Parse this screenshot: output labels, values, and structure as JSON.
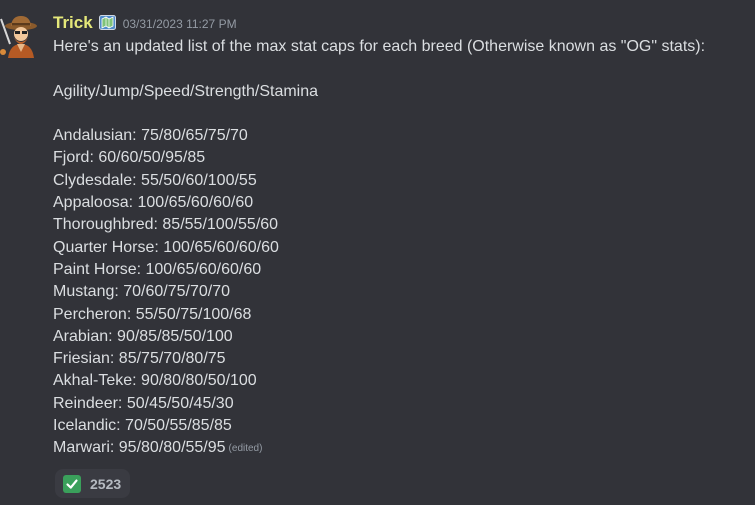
{
  "author": {
    "username": "Trick",
    "role_icon": "map-icon",
    "avatar": "cowboy-avatar",
    "name_color": "#e5e87a"
  },
  "timestamp": "03/31/2023 11:27 PM",
  "message": {
    "intro": "Here's an updated list of the max stat caps for each breed (Otherwise known as \"OG\" stats):",
    "stat_order": "Agility/Jump/Speed/Strength/Stamina",
    "breeds": [
      "Andalusian: 75/80/65/75/70",
      "Fjord: 60/60/50/95/85",
      "Clydesdale: 55/50/60/100/55",
      "Appaloosa: 100/65/60/60/60",
      "Thoroughbred: 85/55/100/55/60",
      "Quarter Horse: 100/65/60/60/60",
      "Paint Horse: 100/65/60/60/60",
      "Mustang: 70/60/75/70/70",
      "Percheron: 55/50/75/100/68",
      "Arabian: 90/85/85/50/100",
      "Friesian: 85/75/70/80/75",
      "Akhal-Teke: 90/80/80/50/100",
      "Reindeer: 50/45/50/45/30",
      "Icelandic: 70/50/55/85/85",
      "Marwari: 95/80/80/55/95"
    ],
    "edited_label": "(edited)"
  },
  "reaction": {
    "emoji": "check-mark-icon",
    "count": "2523",
    "emoji_color": "#3aa05b"
  }
}
